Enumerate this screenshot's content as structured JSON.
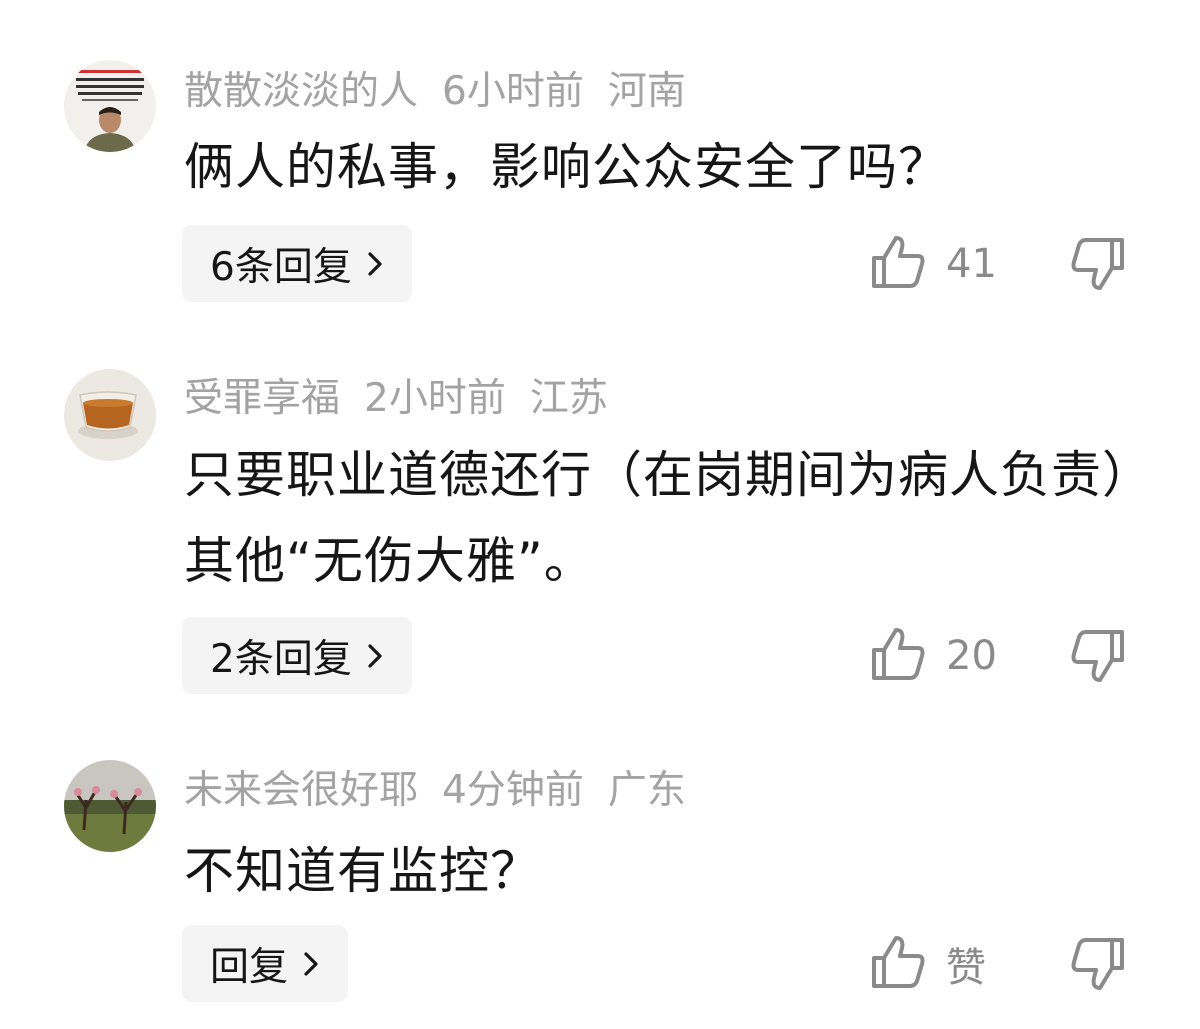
{
  "comments": [
    {
      "user": "散散淡淡的人",
      "time": "6小时前",
      "location": "河南",
      "text": "俩人的私事，影响公众安全了吗？",
      "reply_label": "6条回复",
      "likes": "41",
      "avatar_icon": "person-portrait"
    },
    {
      "user": "受罪享福",
      "time": "2小时前",
      "location": "江苏",
      "text": "只要职业道德还行（在岗期间为病人负责）其他“无伤大雅”。",
      "reply_label": "2条回复",
      "likes": "20",
      "avatar_icon": "tea-cup"
    },
    {
      "user": "未来会很好耶",
      "time": "4分钟前",
      "location": "广东",
      "text": "不知道有监控？",
      "reply_label": "回复",
      "likes": "赞",
      "avatar_icon": "orchard"
    }
  ],
  "icons": {
    "like": "thumbs-up-icon",
    "dislike": "thumbs-down-icon",
    "chevron": "chevron-right-icon"
  },
  "colors": {
    "meta": "#a3a3a3",
    "text": "#161616",
    "button_bg": "#f4f4f4",
    "icon": "#8a8a8a"
  }
}
